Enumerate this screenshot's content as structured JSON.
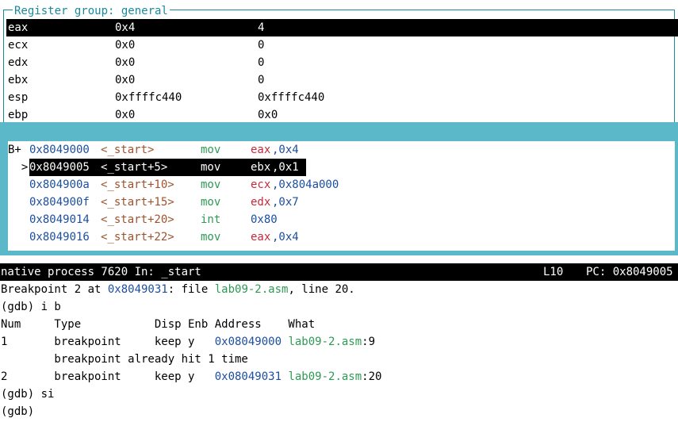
{
  "registers": {
    "title": "Register group: general",
    "rows": [
      {
        "name": "eax",
        "hex": "0x4",
        "natural": "4",
        "selected": true
      },
      {
        "name": "ecx",
        "hex": "0x0",
        "natural": "0"
      },
      {
        "name": "edx",
        "hex": "0x0",
        "natural": "0"
      },
      {
        "name": "ebx",
        "hex": "0x0",
        "natural": "0"
      },
      {
        "name": "esp",
        "hex": "0xffffc440",
        "natural": "0xffffc440"
      },
      {
        "name": "ebp",
        "hex": "0x0",
        "natural": "0x0"
      }
    ]
  },
  "assembly": {
    "rows": [
      {
        "marker": "B+ ",
        "addr": "0x8049000",
        "sym": "<_start>",
        "mnemonic": "mov",
        "op_reg": "eax",
        "op_rest": ",0x4"
      },
      {
        "marker": "  >",
        "addr": "0x8049005",
        "sym": "<_start+5>",
        "mnemonic": "mov",
        "op_reg": "ebx",
        "op_rest": ",0x1",
        "current": true
      },
      {
        "marker": "   ",
        "addr": "0x804900a",
        "sym": "<_start+10>",
        "mnemonic": "mov",
        "op_reg": "ecx",
        "op_rest": ",0x804a000"
      },
      {
        "marker": "   ",
        "addr": "0x804900f",
        "sym": "<_start+15>",
        "mnemonic": "mov",
        "op_reg": "edx",
        "op_rest": ",0x7"
      },
      {
        "marker": "   ",
        "addr": "0x8049014",
        "sym": "<_start+20>",
        "mnemonic": "int",
        "op_reg": "",
        "op_rest": "0x80"
      },
      {
        "marker": "   ",
        "addr": "0x8049016",
        "sym": "<_start+22>",
        "mnemonic": "mov",
        "op_reg": "eax",
        "op_rest": ",0x4"
      }
    ]
  },
  "status": {
    "left": "native process 7620 In: _start",
    "line": "L10",
    "pc": "PC: 0x8049005"
  },
  "console": {
    "bp_msg_pre": "Breakpoint 2 at ",
    "bp_msg_addr": "0x8049031",
    "bp_msg_mid": ": file ",
    "bp_msg_file": "lab09-2.asm",
    "bp_msg_post": ", line 20.",
    "cmd1": "(gdb) i b",
    "header": "Num     Type           Disp Enb Address    What",
    "bp1_pre": "1       breakpoint     keep y   ",
    "bp1_addr": "0x08049000",
    "bp1_file": "lab09-2.asm",
    "bp1_line": ":9",
    "bp1_hits": "        breakpoint already hit 1 time",
    "bp2_pre": "2       breakpoint     keep y   ",
    "bp2_addr": "0x08049031",
    "bp2_file": "lab09-2.asm",
    "bp2_line": ":20",
    "cmd2": "(gdb) si",
    "prompt": "(gdb) "
  }
}
